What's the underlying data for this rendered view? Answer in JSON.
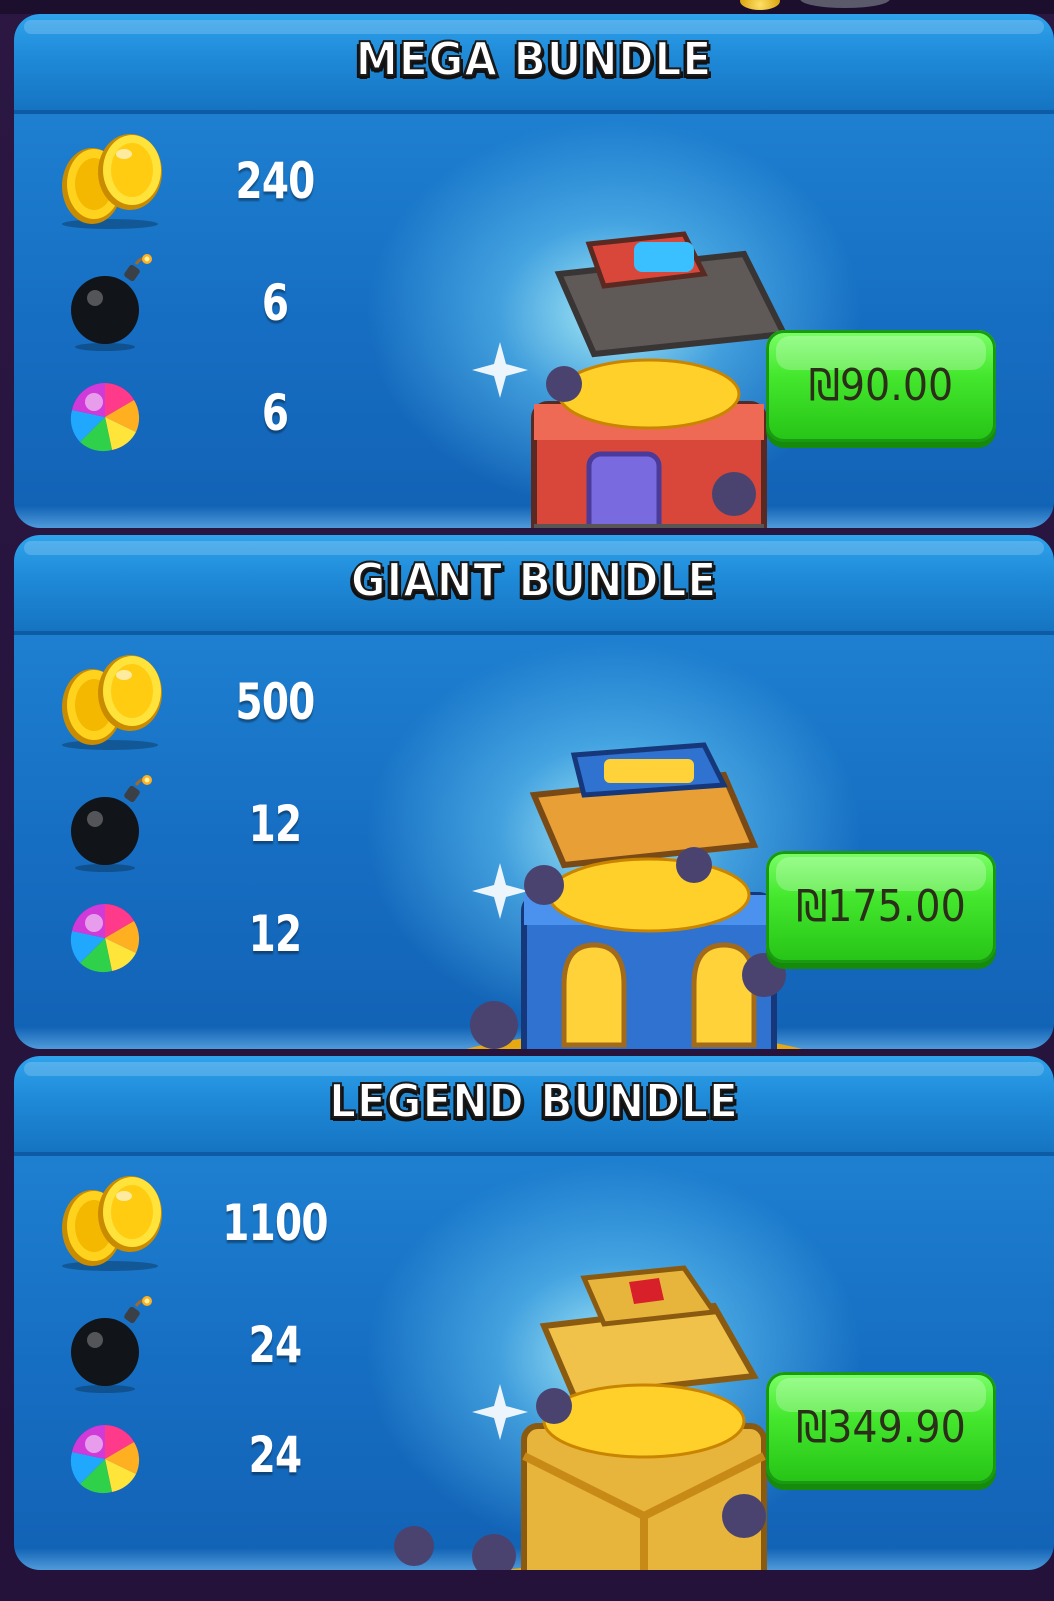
{
  "bundles": [
    {
      "title": "MEGA BUNDLE",
      "coins": "240",
      "bombs": "6",
      "rainbows": "6",
      "price": "₪90.00",
      "chest_color": "red"
    },
    {
      "title": "GIANT BUNDLE",
      "coins": "500",
      "bombs": "12",
      "rainbows": "12",
      "price": "₪175.00",
      "chest_color": "blue"
    },
    {
      "title": "LEGEND BUNDLE",
      "coins": "1100",
      "bombs": "24",
      "rainbows": "24",
      "price": "₪349.90",
      "chest_color": "gold"
    }
  ],
  "icons": {
    "coin": "coin-icon",
    "bomb": "bomb-icon",
    "rainbow": "rainbow-candy-icon",
    "chest": "treasure-chest-icon",
    "sparkle": "sparkle-icon"
  },
  "colors": {
    "header": "#1f8ad8",
    "body": "#166ec2",
    "button": "#45e82e",
    "button_text": "#2b2f1a",
    "chest_red": "#d9463a",
    "chest_blue": "#2f72d0",
    "chest_gold": "#e8b53c"
  }
}
